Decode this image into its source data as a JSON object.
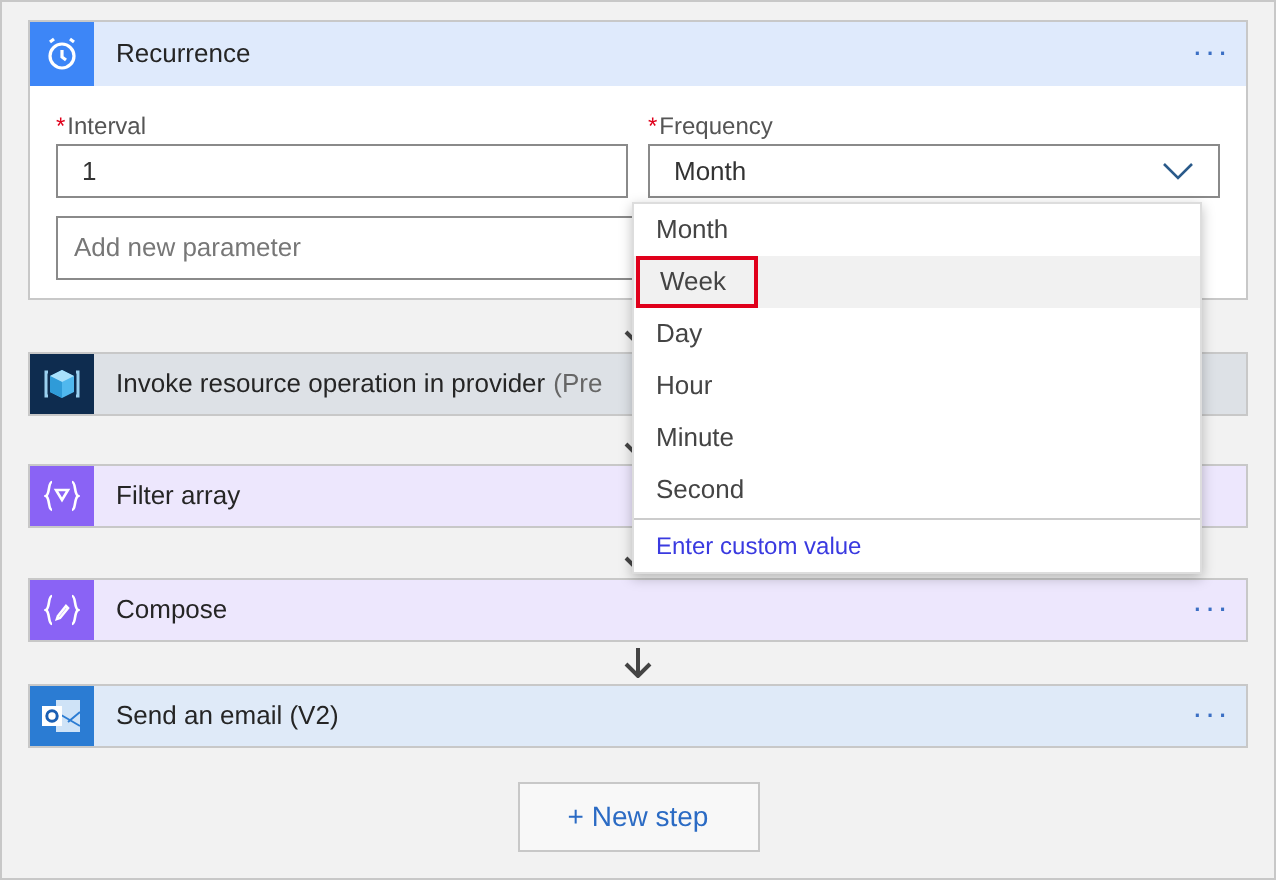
{
  "trigger": {
    "title": "Recurrence",
    "more": "···",
    "fields": [
      {
        "label": "Interval",
        "required_mark": "*",
        "value": "1"
      },
      {
        "label": "Frequency",
        "required_mark": "*",
        "value": "Month",
        "expanded": true
      }
    ],
    "add_parameter": {
      "placeholder": "Add new parameter"
    }
  },
  "frequency_options": [
    {
      "label": "Month",
      "selected": false
    },
    {
      "label": "Week",
      "selected": true
    },
    {
      "label": "Day",
      "selected": false
    },
    {
      "label": "Hour",
      "selected": false
    },
    {
      "label": "Minute",
      "selected": false
    },
    {
      "label": "Second",
      "selected": false
    }
  ],
  "custom_value_link": "Enter custom value",
  "steps": [
    {
      "kind": "resource",
      "title": "Invoke resource operation in provider",
      "suffix": "(Pre"
    },
    {
      "kind": "filter",
      "title": "Filter array"
    },
    {
      "kind": "compose",
      "title": "Compose",
      "more": "···"
    },
    {
      "kind": "email",
      "title": "Send an email (V2)",
      "more": "···"
    }
  ],
  "new_step_button": "+ New step"
}
